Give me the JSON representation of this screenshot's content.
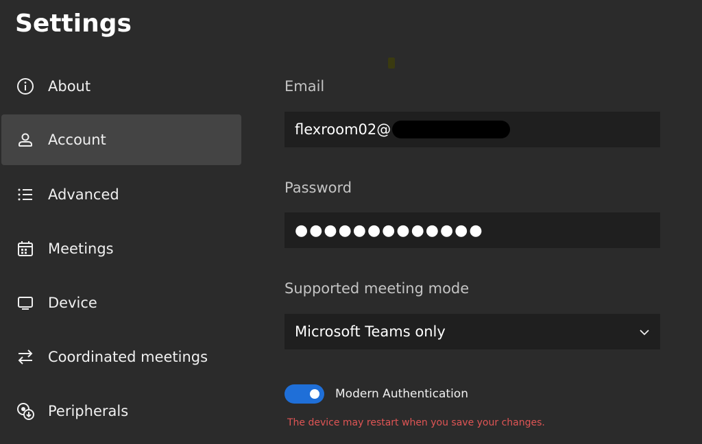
{
  "page": {
    "title": "Settings"
  },
  "sidebar": {
    "items": [
      {
        "label": "About",
        "icon": "info-icon",
        "active": false
      },
      {
        "label": "Account",
        "icon": "person-icon",
        "active": true
      },
      {
        "label": "Advanced",
        "icon": "list-icon",
        "active": false
      },
      {
        "label": "Meetings",
        "icon": "calendar-icon",
        "active": false
      },
      {
        "label": "Device",
        "icon": "monitor-icon",
        "active": false
      },
      {
        "label": "Coordinated meetings",
        "icon": "swap-arrows-icon",
        "active": false
      },
      {
        "label": "Peripherals",
        "icon": "peripherals-icon",
        "active": false
      }
    ]
  },
  "account": {
    "email_label": "Email",
    "email_value": "flexroom02@",
    "password_label": "Password",
    "password_value": "●●●●●●●●●●●●●",
    "meeting_mode_label": "Supported meeting mode",
    "meeting_mode_value": "Microsoft Teams only",
    "modern_auth_label": "Modern Authentication",
    "modern_auth_enabled": true,
    "restart_warning": "The device may restart when you save your changes."
  },
  "colors": {
    "background": "#2b2b2b",
    "active_item": "#444444",
    "field_bg": "#1f1f1f",
    "toggle_on": "#1f6fd8",
    "warning": "#e05555"
  }
}
